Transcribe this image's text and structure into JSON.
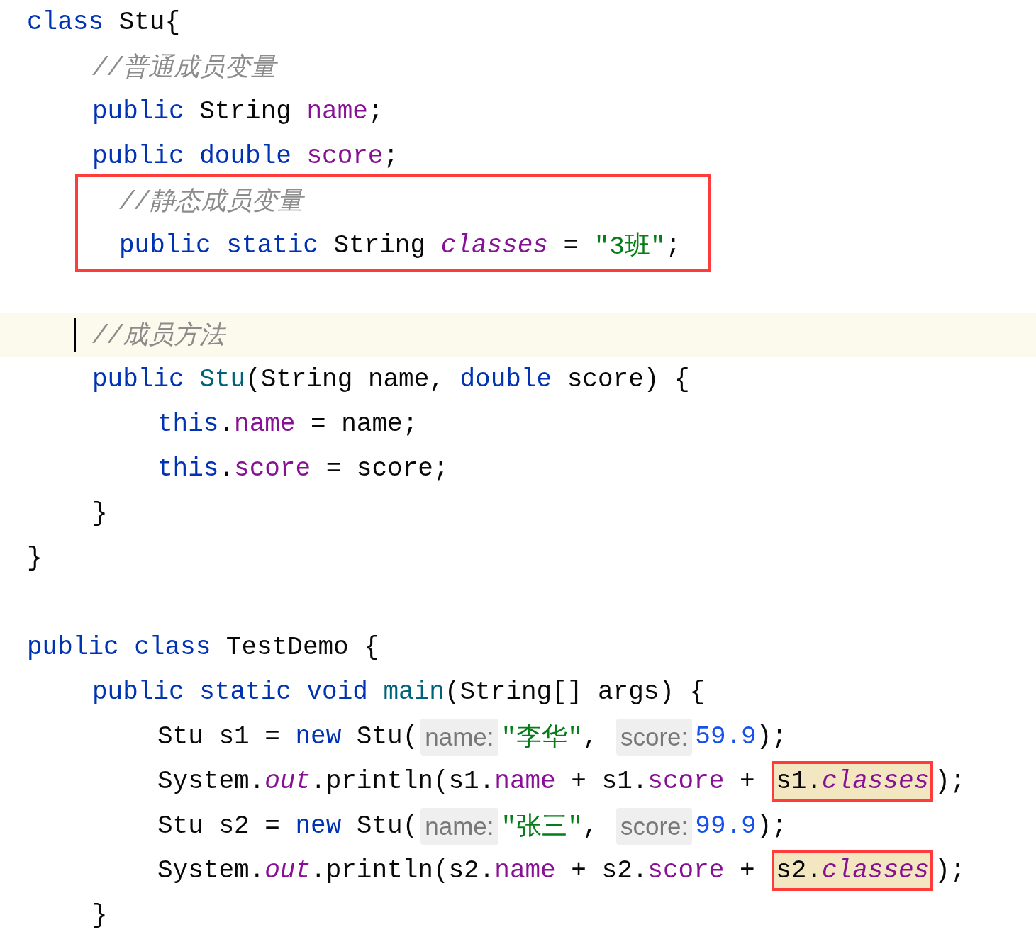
{
  "editor": {
    "lines": [
      {
        "kind": "code",
        "tokens": [
          {
            "kind": "keyword",
            "text": "class "
          },
          {
            "kind": "plain",
            "text": "Stu{"
          }
        ],
        "children": [
          {
            "kind": "code",
            "tokens": [
              {
                "kind": "comment",
                "text": "//普通成员变量"
              }
            ]
          },
          {
            "kind": "code",
            "tokens": [
              {
                "kind": "keyword",
                "text": "public "
              },
              {
                "kind": "plain",
                "text": "String "
              },
              {
                "kind": "field",
                "text": "name"
              },
              {
                "kind": "plain",
                "text": ";"
              }
            ]
          },
          {
            "kind": "code",
            "tokens": [
              {
                "kind": "keyword",
                "text": "public double "
              },
              {
                "kind": "field",
                "text": "score"
              },
              {
                "kind": "plain",
                "text": ";"
              }
            ]
          },
          {
            "kind": "boxed",
            "lines": [
              {
                "kind": "code",
                "tokens": [
                  {
                    "kind": "comment",
                    "text": "//静态成员变量"
                  }
                ]
              },
              {
                "kind": "code",
                "tokens": [
                  {
                    "kind": "keyword",
                    "text": "public static "
                  },
                  {
                    "kind": "plain",
                    "text": "String "
                  },
                  {
                    "kind": "static_field",
                    "text": "classes"
                  },
                  {
                    "kind": "plain",
                    "text": " = "
                  },
                  {
                    "kind": "string",
                    "text": "\"3班\""
                  },
                  {
                    "kind": "plain",
                    "text": ";"
                  }
                ]
              }
            ]
          },
          {
            "kind": "blank"
          },
          {
            "kind": "code",
            "current": true,
            "tokens": [
              {
                "kind": "comment",
                "text": "//成员方法"
              }
            ]
          },
          {
            "kind": "code",
            "tokens": [
              {
                "kind": "keyword",
                "text": "public "
              },
              {
                "kind": "method",
                "text": "Stu"
              },
              {
                "kind": "plain",
                "text": "(String name, "
              },
              {
                "kind": "keyword",
                "text": "double "
              },
              {
                "kind": "plain",
                "text": "score) {"
              }
            ],
            "children": [
              {
                "kind": "code",
                "tokens": [
                  {
                    "kind": "keyword",
                    "text": "this"
                  },
                  {
                    "kind": "plain",
                    "text": "."
                  },
                  {
                    "kind": "field",
                    "text": "name"
                  },
                  {
                    "kind": "plain",
                    "text": " = name;"
                  }
                ]
              },
              {
                "kind": "code",
                "tokens": [
                  {
                    "kind": "keyword",
                    "text": "this"
                  },
                  {
                    "kind": "plain",
                    "text": "."
                  },
                  {
                    "kind": "field",
                    "text": "score"
                  },
                  {
                    "kind": "plain",
                    "text": " = score;"
                  }
                ]
              }
            ]
          },
          {
            "kind": "code",
            "tokens": [
              {
                "kind": "plain",
                "text": "}"
              }
            ]
          }
        ]
      },
      {
        "kind": "code",
        "tokens": [
          {
            "kind": "plain",
            "text": "}"
          }
        ]
      },
      {
        "kind": "blank"
      },
      {
        "kind": "code",
        "tokens": [
          {
            "kind": "keyword",
            "text": "public class "
          },
          {
            "kind": "plain",
            "text": "TestDemo {"
          }
        ],
        "children": [
          {
            "kind": "code",
            "tokens": [
              {
                "kind": "keyword",
                "text": "public static void "
              },
              {
                "kind": "method",
                "text": "main"
              },
              {
                "kind": "plain",
                "text": "(String[] args) {"
              }
            ],
            "children": [
              {
                "kind": "code",
                "tokens": [
                  {
                    "kind": "plain",
                    "text": "Stu s1 = "
                  },
                  {
                    "kind": "keyword",
                    "text": "new "
                  },
                  {
                    "kind": "plain",
                    "text": "Stu("
                  },
                  {
                    "kind": "hint",
                    "text": "name:"
                  },
                  {
                    "kind": "string",
                    "text": "\"李华\""
                  },
                  {
                    "kind": "plain",
                    "text": ", "
                  },
                  {
                    "kind": "hint",
                    "text": "score:"
                  },
                  {
                    "kind": "number",
                    "text": "59.9"
                  },
                  {
                    "kind": "plain",
                    "text": ");"
                  }
                ]
              },
              {
                "kind": "code",
                "tokens": [
                  {
                    "kind": "plain",
                    "text": "System."
                  },
                  {
                    "kind": "static_field",
                    "text": "out"
                  },
                  {
                    "kind": "plain",
                    "text": ".println(s1."
                  },
                  {
                    "kind": "field",
                    "text": "name"
                  },
                  {
                    "kind": "plain",
                    "text": " + s1."
                  },
                  {
                    "kind": "field",
                    "text": "score"
                  },
                  {
                    "kind": "plain",
                    "text": " + "
                  },
                  {
                    "kind": "marked",
                    "tokens": [
                      {
                        "kind": "plain",
                        "text": "s1."
                      },
                      {
                        "kind": "static_field",
                        "text": "classes"
                      }
                    ]
                  },
                  {
                    "kind": "plain",
                    "text": ");"
                  }
                ]
              },
              {
                "kind": "code",
                "tokens": [
                  {
                    "kind": "plain",
                    "text": "Stu s2 = "
                  },
                  {
                    "kind": "keyword",
                    "text": "new "
                  },
                  {
                    "kind": "plain",
                    "text": "Stu("
                  },
                  {
                    "kind": "hint",
                    "text": "name:"
                  },
                  {
                    "kind": "string",
                    "text": "\"张三\""
                  },
                  {
                    "kind": "plain",
                    "text": ", "
                  },
                  {
                    "kind": "hint",
                    "text": "score:"
                  },
                  {
                    "kind": "number",
                    "text": "99.9"
                  },
                  {
                    "kind": "plain",
                    "text": ");"
                  }
                ]
              },
              {
                "kind": "code",
                "tokens": [
                  {
                    "kind": "plain",
                    "text": "System."
                  },
                  {
                    "kind": "static_field",
                    "text": "out"
                  },
                  {
                    "kind": "plain",
                    "text": ".println(s2."
                  },
                  {
                    "kind": "field",
                    "text": "name"
                  },
                  {
                    "kind": "plain",
                    "text": " + s2."
                  },
                  {
                    "kind": "field",
                    "text": "score"
                  },
                  {
                    "kind": "plain",
                    "text": " + "
                  },
                  {
                    "kind": "marked",
                    "tokens": [
                      {
                        "kind": "plain",
                        "text": "s2."
                      },
                      {
                        "kind": "static_field",
                        "text": "classes"
                      }
                    ]
                  },
                  {
                    "kind": "plain",
                    "text": ");"
                  }
                ]
              }
            ]
          },
          {
            "kind": "code",
            "tokens": [
              {
                "kind": "plain",
                "text": "}"
              }
            ]
          }
        ]
      }
    ]
  }
}
